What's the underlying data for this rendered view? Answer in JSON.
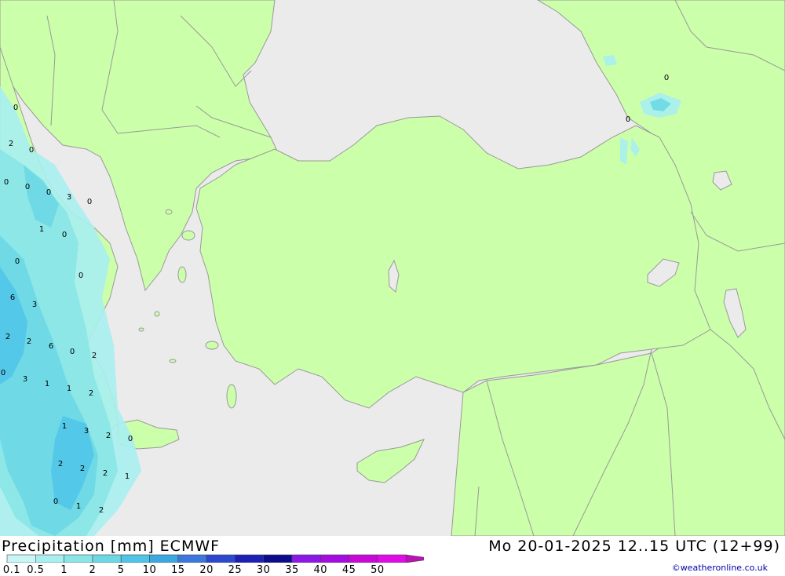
{
  "header": {
    "title": "Precipitation [mm] ECMWF",
    "datetime": "Mo 20-01-2025 12..15 UTC (12+99)",
    "credit": "©weatheronline.co.uk"
  },
  "colors": {
    "sea": "#ebebeb",
    "land": "#ccffaa",
    "border": "#999999"
  },
  "legend": {
    "ticks": [
      "0.1",
      "0.5",
      "1",
      "2",
      "5",
      "10",
      "15",
      "20",
      "25",
      "30",
      "35",
      "40",
      "45",
      "50"
    ],
    "colors": [
      "#c8f5f5",
      "#a8efef",
      "#8ae6e6",
      "#6cd8e6",
      "#50c4e8",
      "#3ca8e0",
      "#3c78dc",
      "#2c48d0",
      "#1c20b4",
      "#0c0c8c",
      "#8c18e8",
      "#a40ce0",
      "#c808d8",
      "#e00ce8",
      "#bc10b8"
    ]
  },
  "map_values": [
    "0",
    "2",
    "0",
    "0",
    "0",
    "0",
    "3",
    "0",
    "1",
    "0",
    "0",
    "0",
    "6",
    "3",
    "2",
    "2",
    "6",
    "0",
    "2",
    "0",
    "3",
    "1",
    "1",
    "2",
    "1",
    "3",
    "2",
    "0",
    "2",
    "2",
    "2",
    "1",
    "0",
    "1",
    "2",
    "0",
    "0"
  ]
}
